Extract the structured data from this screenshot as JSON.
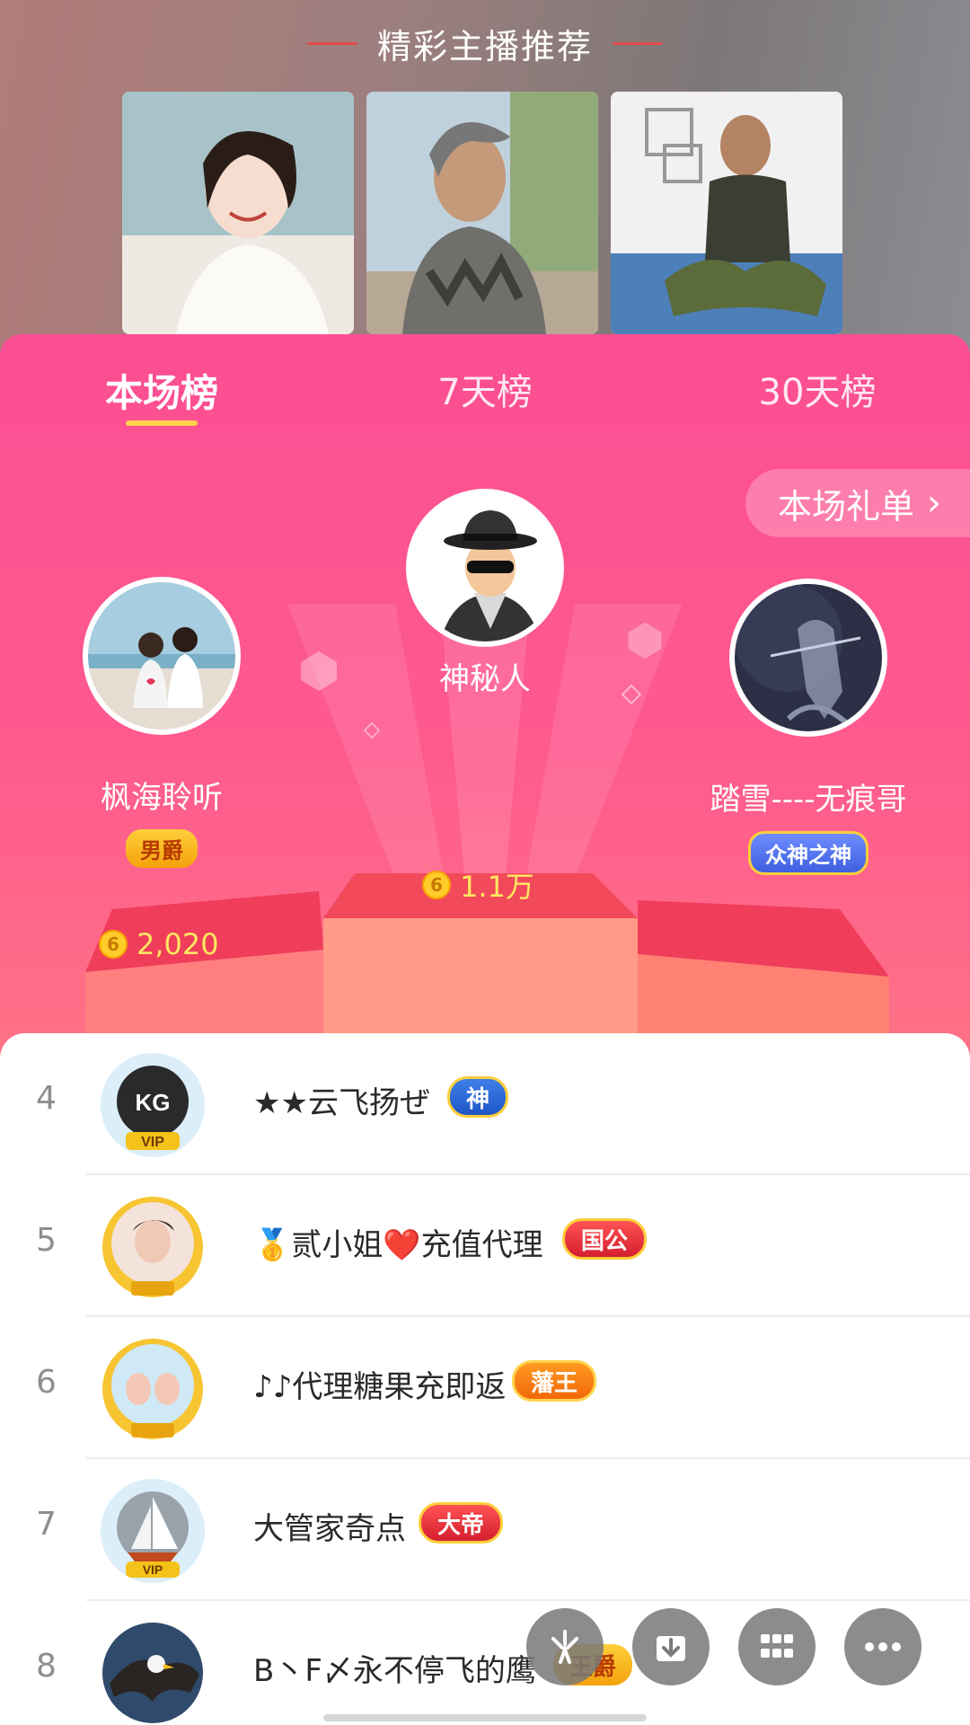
{
  "header": {
    "title": "精彩主播推荐"
  },
  "anchors": [
    {
      "name": "anchor-1"
    },
    {
      "name": "anchor-2"
    },
    {
      "name": "anchor-3"
    }
  ],
  "tabs": [
    {
      "label": "本场榜",
      "active": true
    },
    {
      "label": "7天榜",
      "active": false
    },
    {
      "label": "30天榜",
      "active": false
    }
  ],
  "gift_list": {
    "label": "本场礼单",
    "icon": "chevron-right-icon"
  },
  "podium": {
    "first": {
      "name": "神秘人",
      "score": "1.1万"
    },
    "second": {
      "name": "枫海聆听",
      "badge": "男爵",
      "score": "2,020"
    },
    "third": {
      "name": "踏雪----无痕哥",
      "badge": "众神之神"
    }
  },
  "coin_symbol": "6",
  "list": [
    {
      "rank": "4",
      "name": "★★云飞扬ぜ",
      "badge": "神"
    },
    {
      "rank": "5",
      "name": "🥇贰小姐❤️充值代理",
      "badge": "国公"
    },
    {
      "rank": "6",
      "name": "♪♪代理糖果充即返",
      "badge": "藩王"
    },
    {
      "rank": "7",
      "name": "大管家奇点",
      "badge": "大帝"
    },
    {
      "rank": "8",
      "name": "B丶F〆永不停飞的鹰",
      "badge": "王爵"
    }
  ],
  "colors": {
    "accent": "#fb4e93",
    "underline": "#ffd24a",
    "coin": "#ffcc29"
  }
}
